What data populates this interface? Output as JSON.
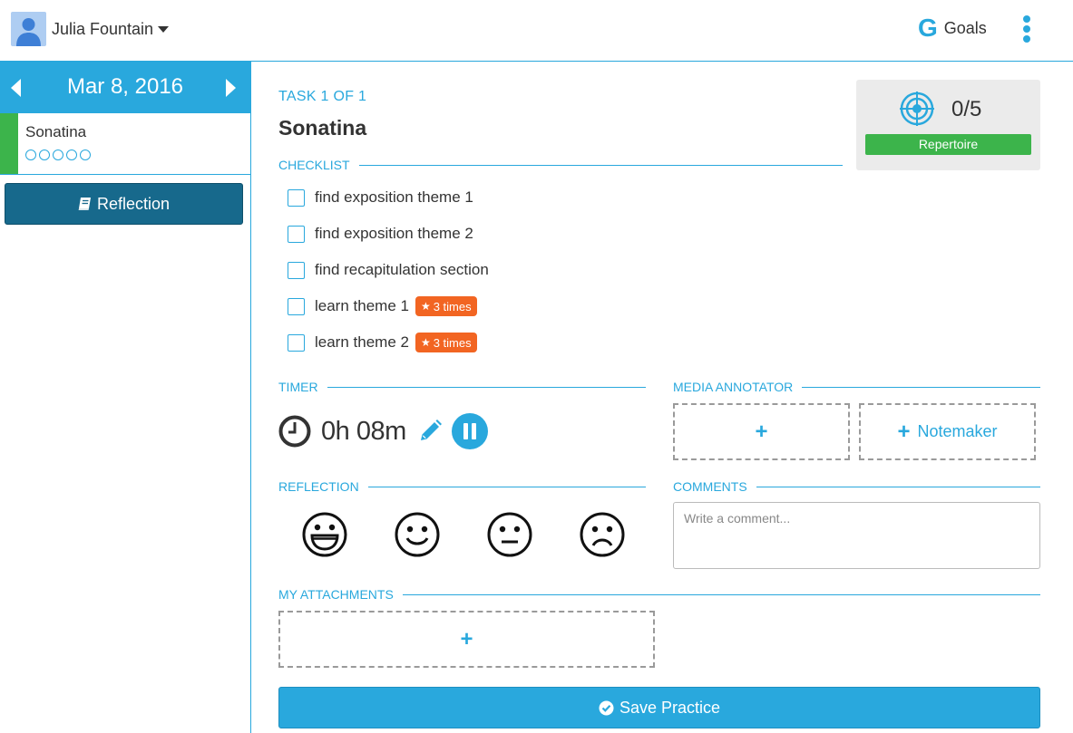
{
  "header": {
    "user_name": "Julia Fountain",
    "goals_letter": "G",
    "goals_label": "Goals",
    "accent_color": "#29a8dd"
  },
  "sidebar": {
    "date": "Mar 8, 2016",
    "task": {
      "name": "Sonatina",
      "progress_dots": 5,
      "accent_color": "#3cb44b"
    },
    "reflection_button": "Reflection"
  },
  "main": {
    "task_label": "TASK 1 OF 1",
    "task_title": "Sonatina",
    "goal": {
      "count": "0/5",
      "category": "Repertoire",
      "icon": "target-icon"
    },
    "checklist_heading": "CHECKLIST",
    "checklist": [
      {
        "label": "find exposition theme 1",
        "checked": false,
        "badge": ""
      },
      {
        "label": "find exposition theme 2",
        "checked": false,
        "badge": ""
      },
      {
        "label": "find recapitulation section",
        "checked": false,
        "badge": ""
      },
      {
        "label": "learn theme 1",
        "checked": false,
        "badge": "3 times"
      },
      {
        "label": "learn theme 2",
        "checked": false,
        "badge": "3 times"
      }
    ],
    "timer_heading": "TIMER",
    "timer_value": "0h 08m",
    "media_heading": "MEDIA ANNOTATOR",
    "media_add": "+",
    "notemaker_label": "Notemaker",
    "reflection_heading": "REFLECTION",
    "reflection_faces": [
      "very-happy-face-icon",
      "happy-face-icon",
      "neutral-face-icon",
      "sad-face-icon"
    ],
    "comments_heading": "COMMENTS",
    "comment_placeholder": "Write a comment...",
    "attachments_heading": "MY ATTACHMENTS",
    "attach_add": "+",
    "save_label": "Save Practice"
  }
}
